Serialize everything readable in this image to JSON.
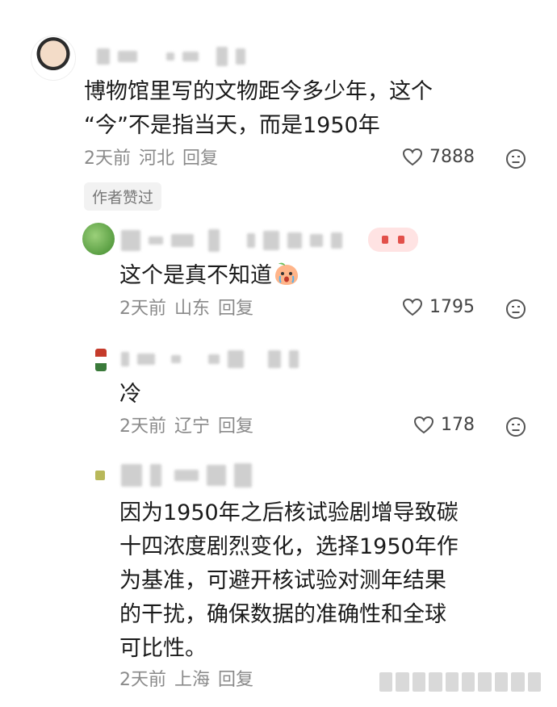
{
  "comments": [
    {
      "lines": [
        "博物馆里写的文物距今多少年，这个",
        "“今”不是指当天，而是1950年"
      ],
      "time": "2天前",
      "location": "河北",
      "reply_label": "回复",
      "likes": "7888",
      "author_tag": "作者赞过"
    },
    {
      "lines": [
        "这个是真不知道"
      ],
      "time": "2天前",
      "location": "山东",
      "reply_label": "回复",
      "likes": "1795"
    },
    {
      "lines": [
        "冷"
      ],
      "time": "2天前",
      "location": "辽宁",
      "reply_label": "回复",
      "likes": "178"
    },
    {
      "lines": [
        "因为1950年之后核试验剧增导致碳",
        "十四浓度剧烈变化，选择1950年作",
        "为基准，可避开核试验对测年结果",
        "的干扰，确保数据的准确性和全球",
        "可比性。"
      ],
      "time": "2天前",
      "location": "上海",
      "reply_label": "回复"
    }
  ],
  "icons": {
    "like": "heart-outline-icon",
    "dislike": "frown-face-icon",
    "emoji": "crying-peach-emoji"
  }
}
